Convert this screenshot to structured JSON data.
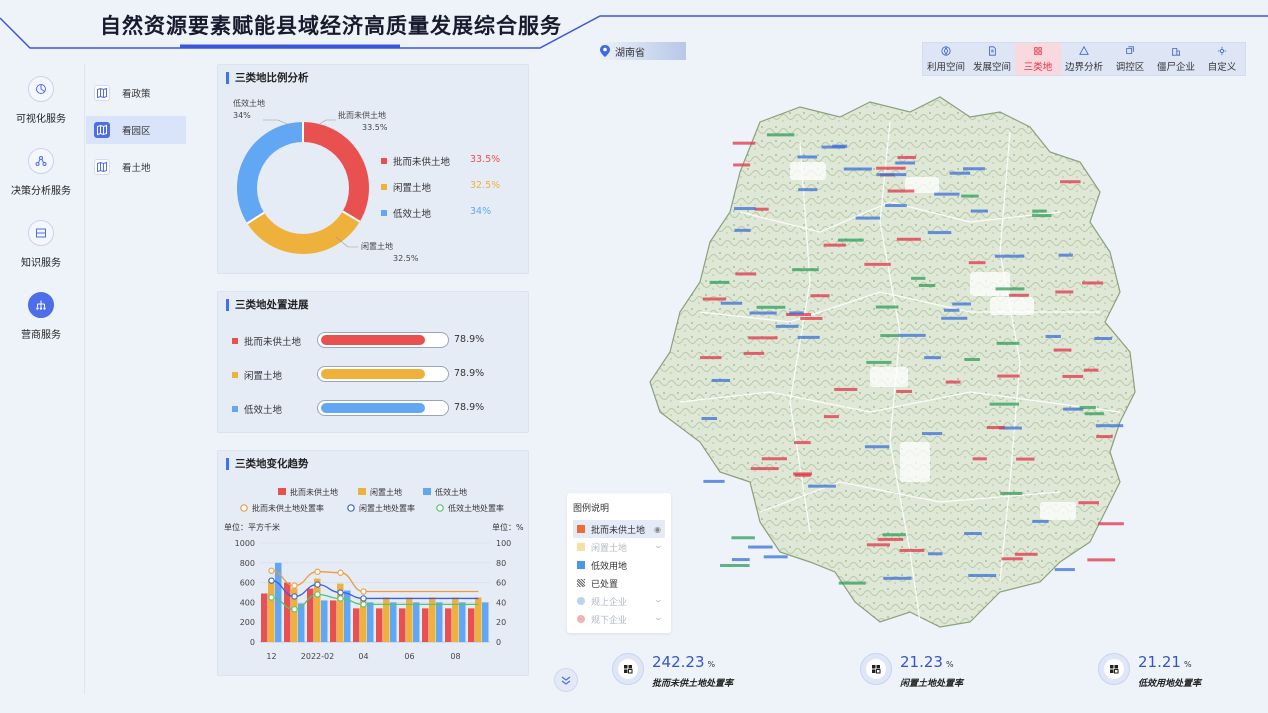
{
  "header": {
    "title": "自然资源要素赋能县域经济高质量发展综合服务",
    "region": "湖南省"
  },
  "toolbar": [
    {
      "label": "利用空间",
      "icon": "compass-icon"
    },
    {
      "label": "发展空间",
      "icon": "document-icon"
    },
    {
      "label": "三类地",
      "icon": "grid-icon",
      "active": true
    },
    {
      "label": "边界分析",
      "icon": "triangle-icon"
    },
    {
      "label": "调控区",
      "icon": "layers-icon"
    },
    {
      "label": "僵尸企业",
      "icon": "building-icon"
    },
    {
      "label": "自定义",
      "icon": "settings-icon"
    }
  ],
  "leftnav": [
    {
      "label": "可视化服务",
      "icon": "chart-icon"
    },
    {
      "label": "决策分析服务",
      "icon": "network-icon"
    },
    {
      "label": "知识服务",
      "icon": "book-icon"
    },
    {
      "label": "营商服务",
      "icon": "org-icon",
      "active": true
    }
  ],
  "subnav": [
    {
      "label": "看政策",
      "icon": "map-book-icon"
    },
    {
      "label": "看园区",
      "icon": "map-book-icon",
      "active": true
    },
    {
      "label": "看土地",
      "icon": "map-book-icon"
    }
  ],
  "ratio_panel": {
    "title": "三类地比例分析",
    "items": [
      {
        "name": "批而未供土地",
        "value": "33.5%",
        "fraction": 0.335,
        "color": "#e8514f"
      },
      {
        "name": "闲置土地",
        "value": "32.5%",
        "fraction": 0.325,
        "color": "#eeb13b"
      },
      {
        "name": "低效土地",
        "value": "34%",
        "fraction": 0.34,
        "color": "#62a7f4"
      }
    ]
  },
  "progress_panel": {
    "title": "三类地处置进展",
    "items": [
      {
        "name": "批而未供土地",
        "value": "78.9%",
        "fraction": 0.789,
        "color": "#e8514f"
      },
      {
        "name": "闲置土地",
        "value": "78.9%",
        "fraction": 0.789,
        "color": "#eeb13b"
      },
      {
        "name": "低效土地",
        "value": "78.9%",
        "fraction": 0.789,
        "color": "#62a7f4"
      }
    ]
  },
  "trend_panel": {
    "title": "三类地变化趋势",
    "legend_bars": [
      "批而未供土地",
      "闲置土地",
      "低效土地"
    ],
    "legend_lines": [
      "批而未供土地处置率",
      "闲置土地处置率",
      "低效土地处置率"
    ],
    "left_unit": "单位：平方千米",
    "right_unit": "单位：%"
  },
  "chart_data": {
    "type": "bar",
    "x": [
      "12",
      "",
      "2022-02",
      "",
      "04",
      "",
      "06",
      "",
      "08",
      ""
    ],
    "y_left_ticks": [
      "1000",
      "800",
      "600",
      "400",
      "200",
      "0"
    ],
    "y_right_ticks": [
      "100",
      "80",
      "60",
      "40",
      "20",
      "0"
    ],
    "ylim": [
      0,
      1000
    ],
    "ylim_right": [
      0,
      100
    ],
    "series": [
      {
        "name": "批而未供土地",
        "kind": "bar",
        "color": "#e8514f",
        "values": [
          490,
          600,
          540,
          420,
          340,
          340,
          340,
          340,
          340,
          340
        ]
      },
      {
        "name": "闲置土地",
        "kind": "bar",
        "color": "#eeb13b",
        "values": [
          630,
          540,
          640,
          590,
          450,
          450,
          450,
          450,
          450,
          450
        ]
      },
      {
        "name": "低效土地",
        "kind": "bar",
        "color": "#62a7f4",
        "values": [
          800,
          390,
          420,
          520,
          400,
          400,
          400,
          400,
          400,
          400
        ]
      },
      {
        "name": "批而未供土地处置率",
        "kind": "line",
        "color": "#ef9a3b",
        "values": [
          72,
          57,
          71,
          70,
          51,
          51,
          51,
          51,
          51,
          51
        ]
      },
      {
        "name": "闲置土地处置率",
        "kind": "line",
        "color": "#3d5fe0",
        "values": [
          62,
          46,
          58,
          50,
          44,
          44,
          44,
          44,
          44,
          44
        ]
      },
      {
        "name": "低效土地处置率",
        "kind": "line",
        "color": "#55c46a",
        "values": [
          45,
          33,
          48,
          44,
          38,
          38,
          38,
          38,
          38,
          38
        ]
      }
    ]
  },
  "map_legend": {
    "title": "图例说明",
    "items": [
      {
        "label": "批而未供土地",
        "color": "#ef6b35",
        "state": "selected",
        "eye": "open"
      },
      {
        "label": "闲置土地",
        "color": "#f6e0a4",
        "state": "dim",
        "eye": "closed"
      },
      {
        "label": "低效用地",
        "color": "#4b95ee",
        "state": "normal"
      },
      {
        "label": "已处置",
        "color": "#888888",
        "state": "normal",
        "pattern": true
      },
      {
        "label": "规上企业",
        "color": "#b9d3f5",
        "state": "dim",
        "eye": "closed",
        "circle": true
      },
      {
        "label": "规下企业",
        "color": "#f0b3b3",
        "state": "dim",
        "eye": "closed",
        "circle": true
      }
    ]
  },
  "stats": [
    {
      "value": "242.23",
      "unit": "%",
      "label": "批而未供土地处置率"
    },
    {
      "value": "21.23",
      "unit": "%",
      "label": "闲置土地处置率"
    },
    {
      "value": "21.21",
      "unit": "%",
      "label": "低效用地处置率"
    }
  ]
}
